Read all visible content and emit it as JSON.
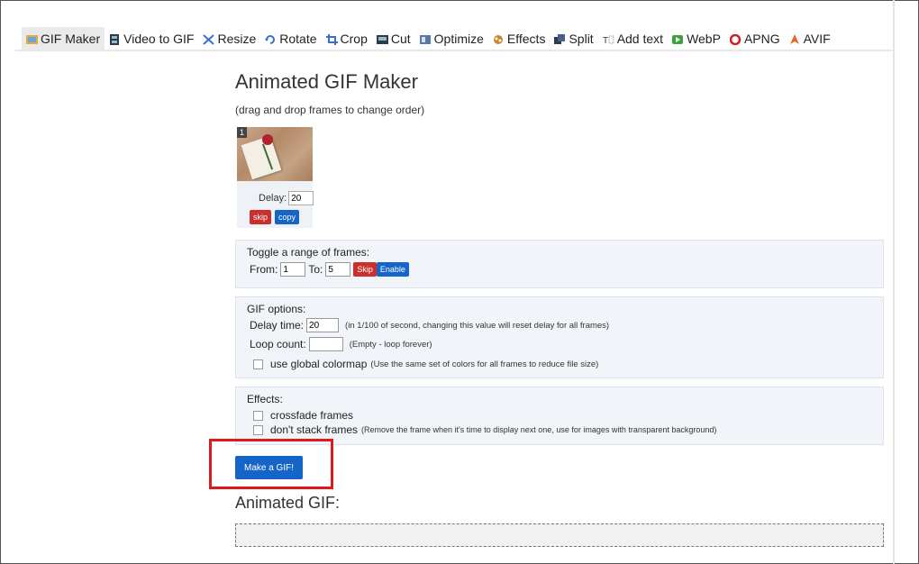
{
  "nav": {
    "items": [
      {
        "label": "GIF Maker",
        "icon": "gif-maker-icon",
        "active": true
      },
      {
        "label": "Video to GIF",
        "icon": "film-icon"
      },
      {
        "label": "Resize",
        "icon": "resize-icon"
      },
      {
        "label": "Rotate",
        "icon": "rotate-icon"
      },
      {
        "label": "Crop",
        "icon": "crop-icon"
      },
      {
        "label": "Cut",
        "icon": "cut-icon"
      },
      {
        "label": "Optimize",
        "icon": "optimize-icon"
      },
      {
        "label": "Effects",
        "icon": "effects-icon"
      },
      {
        "label": "Split",
        "icon": "split-icon"
      },
      {
        "label": "Add text",
        "icon": "text-icon"
      },
      {
        "label": "WebP",
        "icon": "webp-icon"
      },
      {
        "label": "APNG",
        "icon": "apng-icon"
      },
      {
        "label": "AVIF",
        "icon": "avif-icon"
      }
    ]
  },
  "page": {
    "title": "Animated GIF Maker",
    "subtitle": "(drag and drop frames to change order)"
  },
  "frame": {
    "number": "1",
    "delay_label": "Delay:",
    "delay_value": "20",
    "skip_label": "skip",
    "copy_label": "copy"
  },
  "toggle": {
    "header": "Toggle a range of frames:",
    "from_label": "From:",
    "from_value": "1",
    "to_label": "To:",
    "to_value": "5",
    "skip_label": "Skip",
    "enable_label": "Enable"
  },
  "options": {
    "header": "GIF options:",
    "delay_label": "Delay time:",
    "delay_value": "20",
    "delay_hint": "(in 1/100 of second, changing this value will reset delay for all frames)",
    "loop_label": "Loop count:",
    "loop_value": "",
    "loop_hint": "(Empty - loop forever)",
    "colormap_label": "use global colormap",
    "colormap_hint": "(Use the same set of colors for all frames to reduce file size)"
  },
  "effects": {
    "header": "Effects:",
    "crossfade_label": "crossfade frames",
    "nostack_label": "don't stack frames",
    "nostack_hint": "(Remove the frame when it's time to display next one, use for images with transparent background)"
  },
  "make_button": "Make a GIF!",
  "result_title": "Animated GIF:",
  "colors": {
    "accent_blue": "#1565c8",
    "danger_red": "#c9302c",
    "highlight": "#e0191c"
  }
}
